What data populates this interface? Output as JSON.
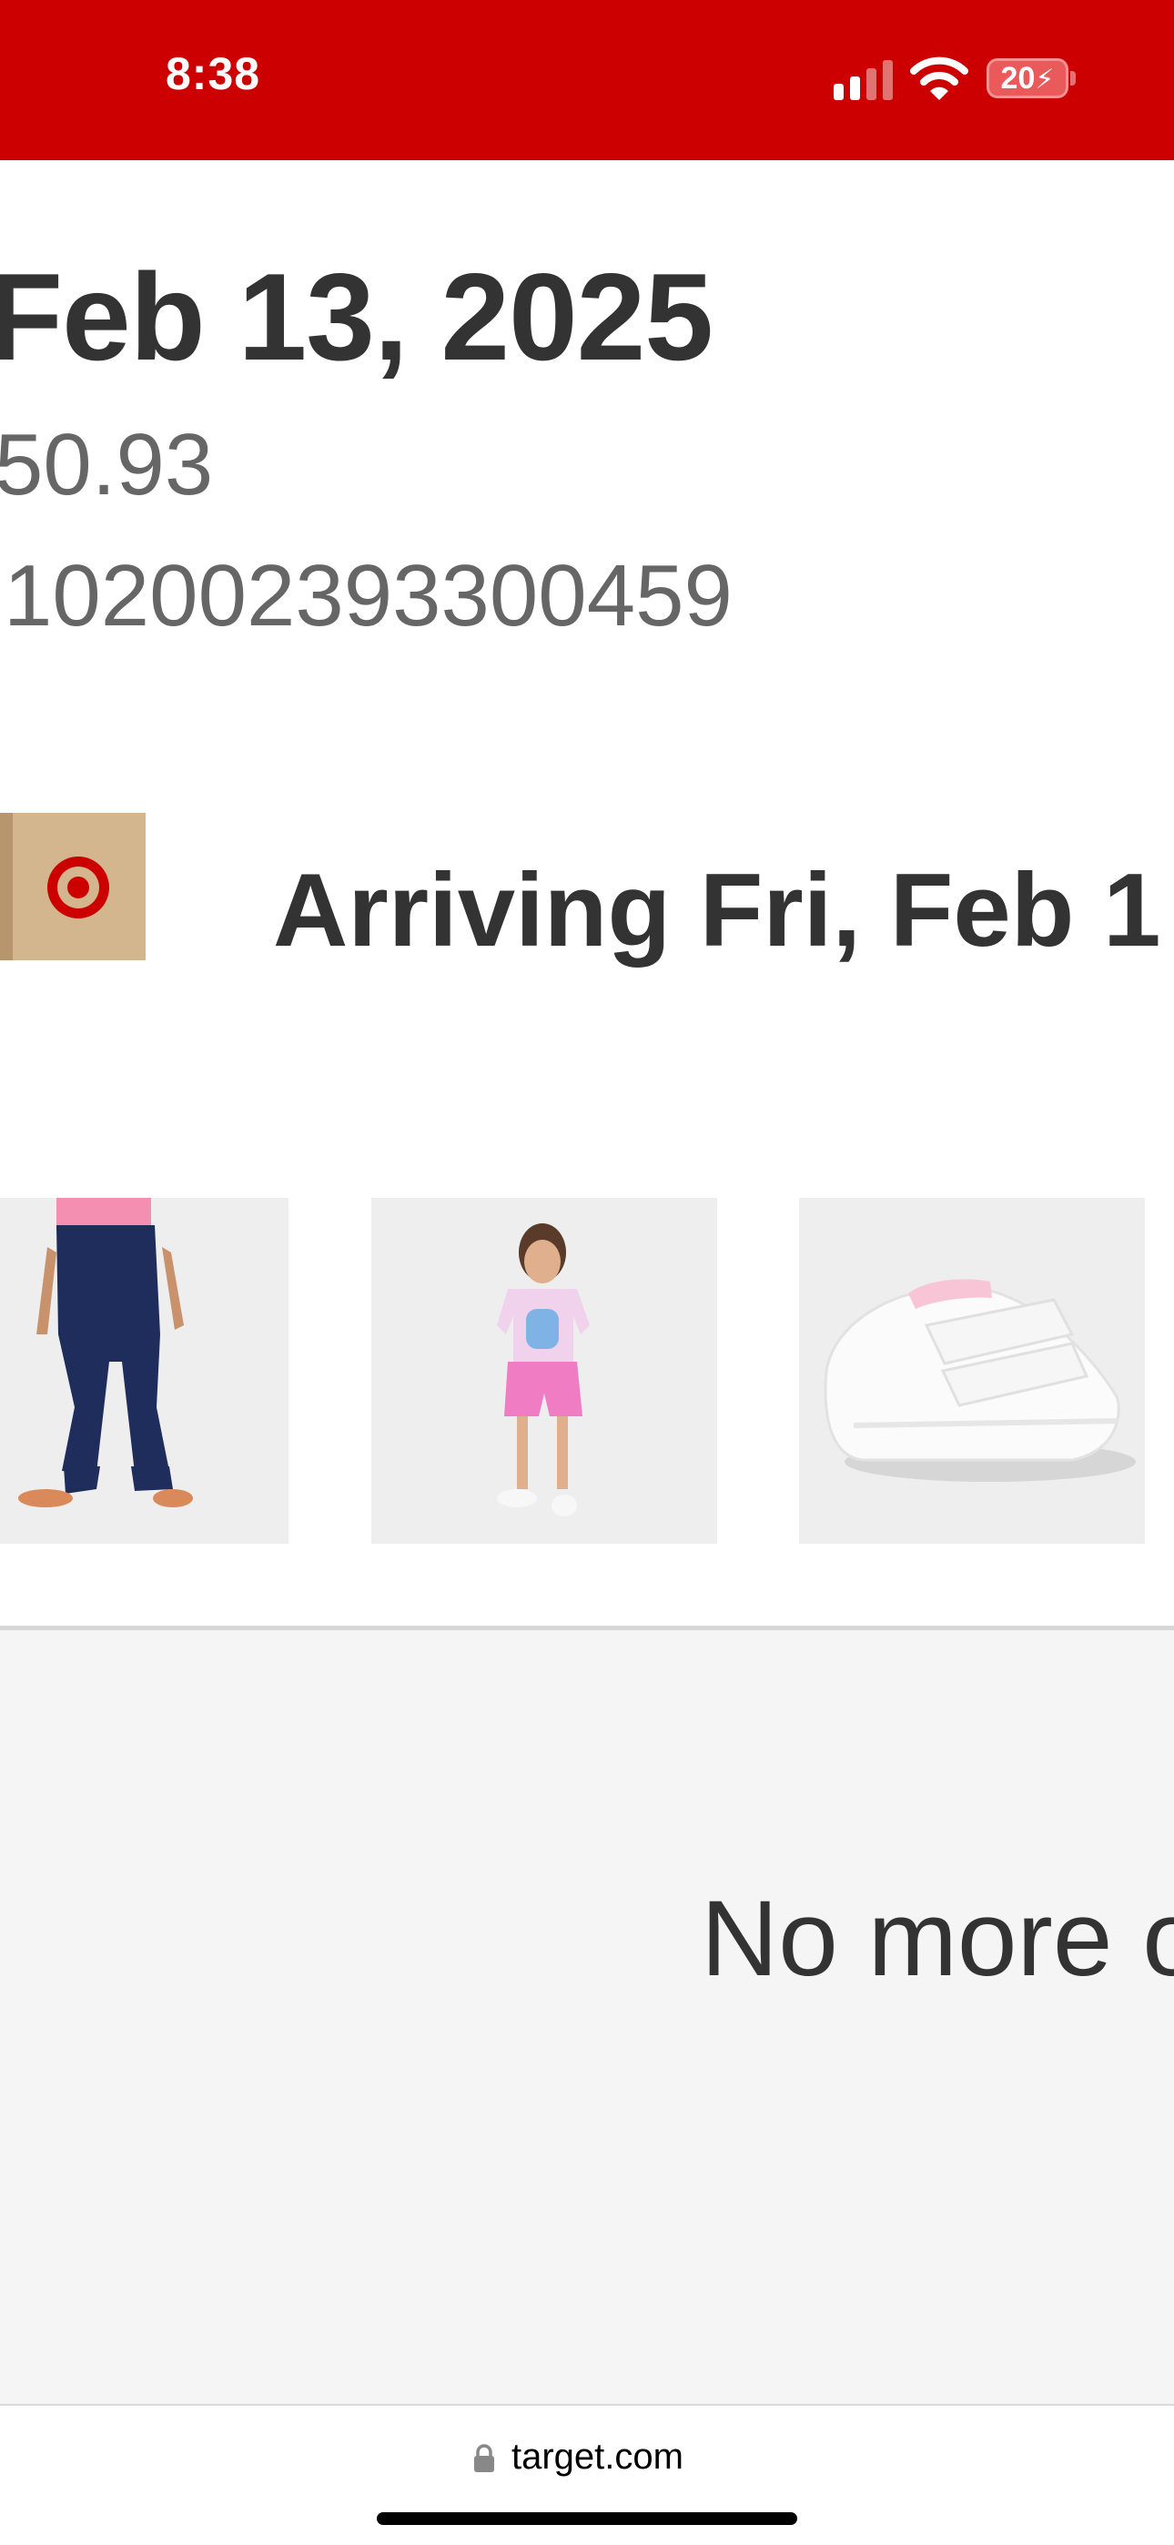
{
  "status_bar": {
    "time": "8:38",
    "battery": "20",
    "signal_icon": "cellular-signal-icon",
    "wifi_icon": "wifi-icon",
    "battery_icon": "battery-charging-icon",
    "background_color": "#cc0000"
  },
  "order": {
    "date": "Feb 13, 2025",
    "total": "50.93",
    "number": "102002393300459"
  },
  "shipment": {
    "icon": "target-box-icon",
    "status": "Arriving Fri, Feb 1"
  },
  "items": [
    {
      "name": "jeans-product-image"
    },
    {
      "name": "bluey-outfit-product-image"
    },
    {
      "name": "white-sneaker-product-image"
    }
  ],
  "end_message": "No more o",
  "browser": {
    "url": "target.com",
    "lock_icon": "lock-icon"
  }
}
